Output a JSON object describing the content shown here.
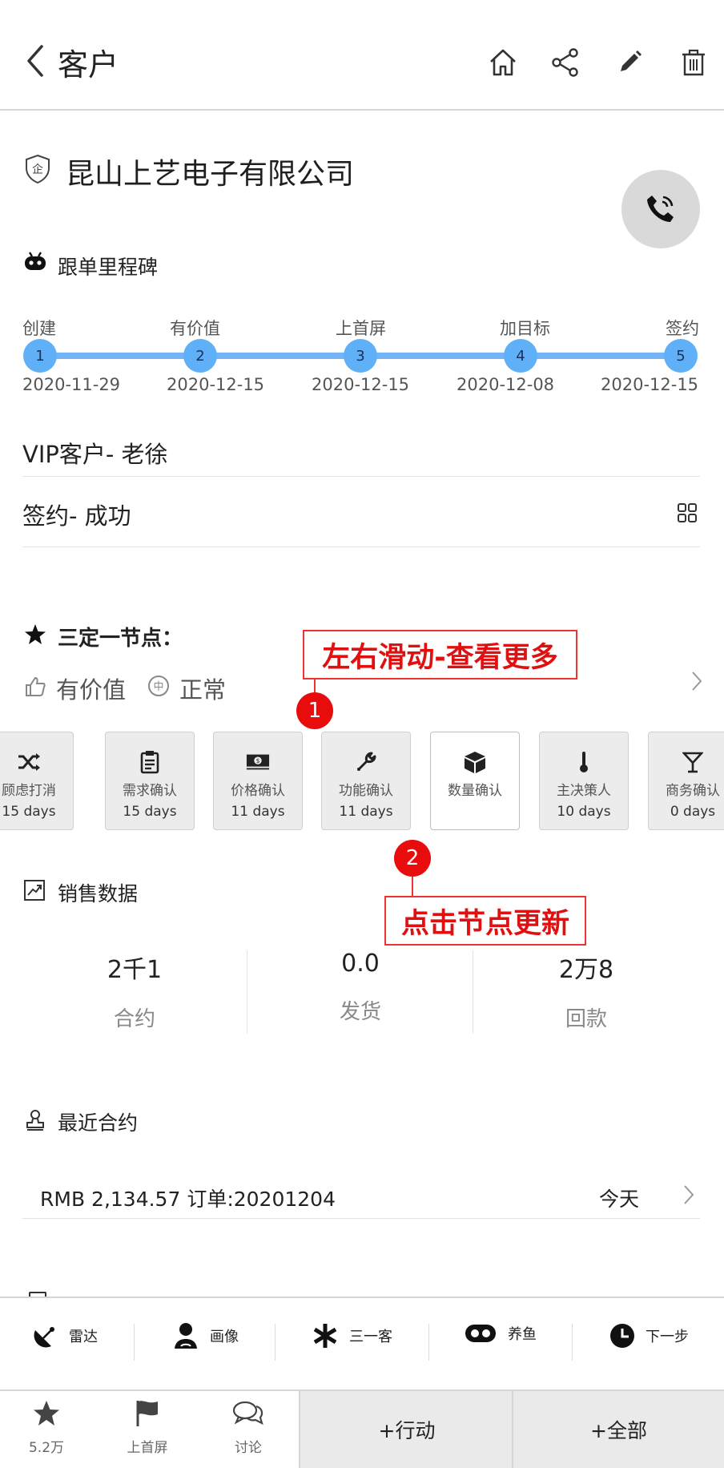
{
  "header": {
    "title": "客户"
  },
  "company": {
    "name": "昆山上艺电子有限公司"
  },
  "milestones": {
    "title": "跟单里程碑",
    "items": [
      {
        "label": "创建",
        "num": "1",
        "date": "2020-11-29"
      },
      {
        "label": "有价值",
        "num": "2",
        "date": "2020-12-15"
      },
      {
        "label": "上首屏",
        "num": "3",
        "date": "2020-12-15"
      },
      {
        "label": "加目标",
        "num": "4",
        "date": "2020-12-08"
      },
      {
        "label": "签约",
        "num": "5",
        "date": "2020-12-15"
      }
    ]
  },
  "info": {
    "vip": "VIP客户- 老徐",
    "signed": "签约- 成功"
  },
  "sanding": {
    "title": "三定一节点：",
    "value_label": "有价值",
    "status_label": "正常",
    "nodes": [
      {
        "name": "顾虑打消",
        "days": "15 days",
        "icon": "shuffle-icon"
      },
      {
        "name": "需求确认",
        "days": "15 days",
        "icon": "clipboard-icon"
      },
      {
        "name": "价格确认",
        "days": "11 days",
        "icon": "money-icon"
      },
      {
        "name": "功能确认",
        "days": "11 days",
        "icon": "wrench-icon"
      },
      {
        "name": "数量确认",
        "days": "",
        "icon": "cube-icon"
      },
      {
        "name": "主决策人",
        "days": "10 days",
        "icon": "thermometer-icon"
      },
      {
        "name": "商务确认",
        "days": "0 days",
        "icon": "cocktail-icon"
      }
    ]
  },
  "annotations": {
    "callout1": "左右滑动-查看更多",
    "badge1": "1",
    "callout2": "点击节点更新",
    "badge2": "2"
  },
  "sales": {
    "title": "销售数据",
    "stats": [
      {
        "value": "2千1",
        "label": "合约"
      },
      {
        "value": "0.0",
        "label": "发货"
      },
      {
        "value": "2万8",
        "label": "回款"
      }
    ]
  },
  "contracts": {
    "title": "最近合约",
    "item": {
      "text": "RMB 2,134.57  订单:20201204",
      "date": "今天"
    }
  },
  "actions": [
    {
      "label": "雷达",
      "icon": "radar-icon"
    },
    {
      "label": "画像",
      "icon": "person-icon"
    },
    {
      "label": "三一客",
      "icon": "asterisk-icon"
    },
    {
      "label": "养鱼",
      "icon": "fish-icon"
    },
    {
      "label": "下一步",
      "icon": "clock-icon"
    }
  ],
  "tabs": [
    {
      "label": "5.2万",
      "icon": "star-icon"
    },
    {
      "label": "上首屏",
      "icon": "flag-icon"
    },
    {
      "label": "讨论",
      "icon": "chat-icon"
    }
  ],
  "buttons": {
    "action": "+行动",
    "all": "+全部"
  },
  "colors": {
    "milestone": "#5fb0f7",
    "annotation": "#e01010",
    "call_button": "#d9d9d9"
  }
}
